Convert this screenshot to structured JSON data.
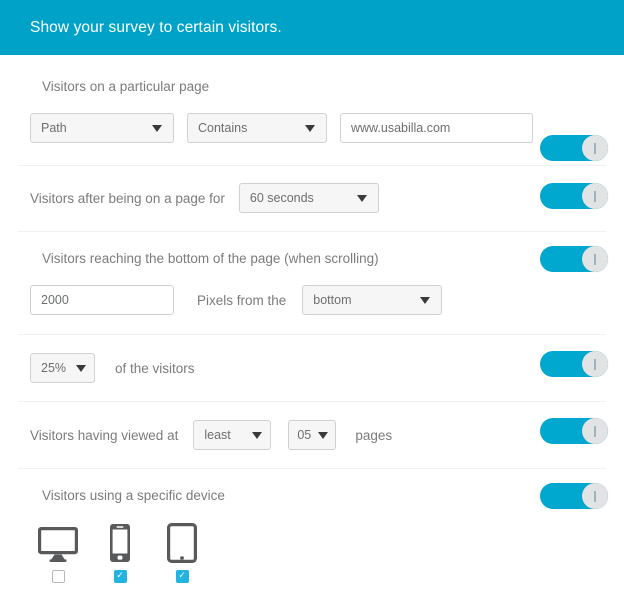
{
  "header": {
    "title": "Show your survey to certain visitors."
  },
  "accent_colors": {
    "header_bg": "#00a3c7",
    "toggle_on": "#00a8d0",
    "checkbox_on": "#22b3e0",
    "text": "#7a7b7d",
    "border": "#cfd0d1"
  },
  "sections": [
    {
      "id": "particular-page",
      "label": "Visitors on a particular page",
      "toggle_on": true,
      "controls": {
        "target_select": "Path",
        "match_select": "Contains",
        "url_value": "www.usabilla.com",
        "url_placeholder": "www.usabilla.com"
      }
    },
    {
      "id": "time-on-page",
      "label": "Visitors after being on a page for",
      "toggle_on": true,
      "controls": {
        "duration_select": "60 seconds"
      }
    },
    {
      "id": "scroll-bottom",
      "label": "Visitors reaching the bottom of the page (when scrolling)",
      "toggle_on": true,
      "controls": {
        "pixels_value": "2000",
        "pixels_placeholder": "2000",
        "pixels_label": "Pixels from the",
        "edge_select": "bottom"
      }
    },
    {
      "id": "percentage-visitors",
      "label": "of the visitors",
      "toggle_on": true,
      "controls": {
        "percent_select": "25%"
      }
    },
    {
      "id": "pages-viewed",
      "label": "Visitors having viewed at",
      "toggle_on": true,
      "controls": {
        "comparator_select": "least",
        "count_select": "05",
        "suffix_label": "pages"
      }
    },
    {
      "id": "specific-device",
      "label": "Visitors using a specific device",
      "toggle_on": true,
      "devices": [
        {
          "icon": "desktop-icon",
          "name": "desktop",
          "checked": false
        },
        {
          "icon": "mobile-phone-icon",
          "name": "mobile",
          "checked": true
        },
        {
          "icon": "tablet-icon",
          "name": "tablet",
          "checked": true
        }
      ]
    }
  ],
  "icons": {
    "caret": "chevron-down-icon",
    "toggle_knob": "toggle-knob-handle",
    "check": "✓"
  }
}
